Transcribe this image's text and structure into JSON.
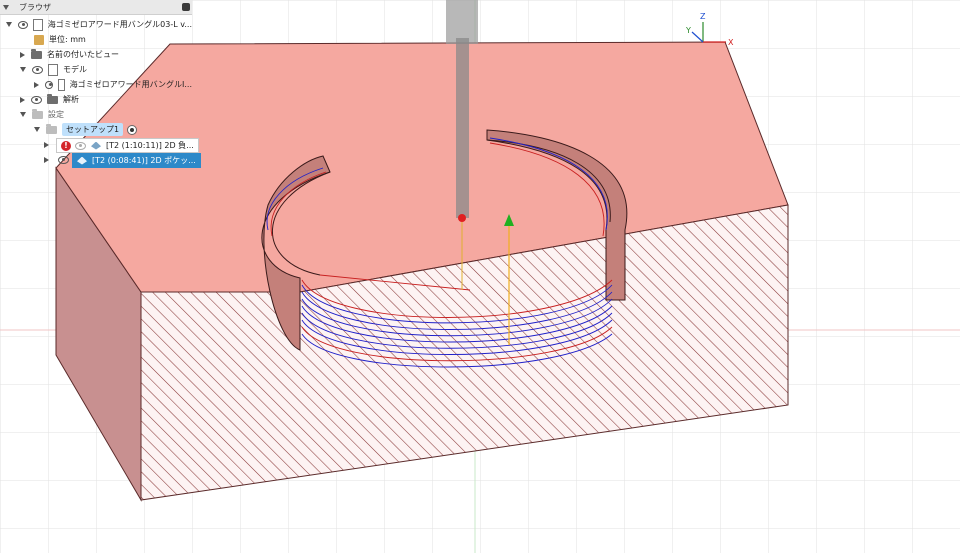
{
  "browser": {
    "title": "ブラウザ",
    "document": "海ゴミゼロアワード用バングル03-L v...",
    "units": "単位: mm",
    "named_views": "名前の付いたビュー",
    "model": "モデル",
    "model_component": "海ゴミゼロアワード用バングルI...",
    "analysis": "解析",
    "setups": "設定",
    "setup": "セットアップ1",
    "operations": [
      {
        "label": "[T2 (1:10:11)] 2D 負...",
        "warning": "!",
        "selected": false
      },
      {
        "label": "[T2 (0:08:41)] 2D ポケッ...",
        "selected": true
      }
    ]
  },
  "viewcube": {
    "x_label": "X",
    "y_label": "Y",
    "z_label": "Z"
  },
  "colors": {
    "stock_top": "#f5a8a0",
    "section": "#b05050",
    "toolpath": "#2020c8",
    "feed": "#c82020",
    "selection": "#2d89c9"
  }
}
